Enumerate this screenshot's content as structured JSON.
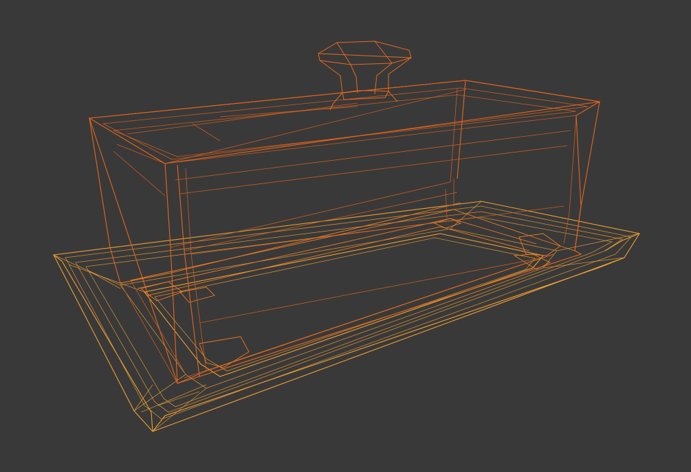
{
  "viewport": {
    "background": "#393939"
  },
  "model": {
    "lid_color": "#e8661a",
    "tray_color": "#f0a030",
    "inner_color": "#ec7a22"
  }
}
